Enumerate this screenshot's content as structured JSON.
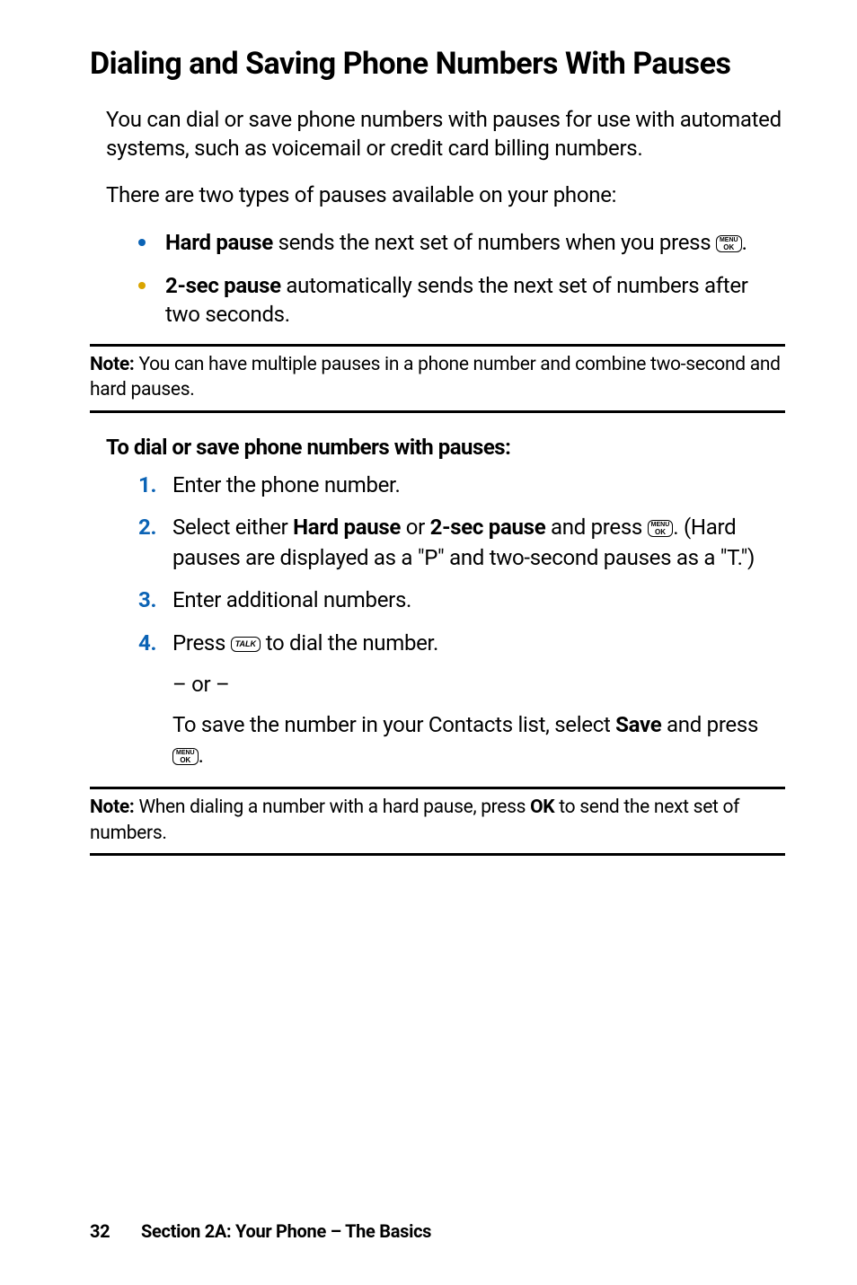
{
  "heading": "Dialing and Saving Phone Numbers With Pauses",
  "intro_para": "You can dial or save phone numbers with pauses for use with automated systems, such as voicemail or credit card billing numbers.",
  "types_para": "There are two types of pauses available on your phone:",
  "bullets": {
    "hard": {
      "label": "Hard pause",
      "text_after_label": " sends the next set of numbers when you press ",
      "text_end": "."
    },
    "twosec": {
      "label": "2-sec pause",
      "text_after_label": " automatically sends the next set of numbers after two seconds."
    }
  },
  "note1": {
    "bold": "Note:",
    "body": " You can have multiple pauses in a phone number and combine two‑second and hard pauses."
  },
  "subhead": "To dial or save phone numbers with pauses:",
  "steps": {
    "s1": {
      "num": "1.",
      "text": "Enter the phone number."
    },
    "s2": {
      "num": "2.",
      "pre": "Select either ",
      "b1": "Hard pause",
      "mid": " or ",
      "b2": "2-sec pause",
      "after": " and press ",
      "tail": ". (Hard pauses are displayed as a \"P\" and two-second pauses as a \"T.\")"
    },
    "s3": {
      "num": "3.",
      "text": "Enter additional numbers."
    },
    "s4": {
      "num": "4.",
      "pre": "Press ",
      "after": " to dial the number.",
      "or": "– or –",
      "save_pre": "To save the number in your Contacts list, select ",
      "save_b": "Save",
      "save_mid": " and press ",
      "save_end": "."
    }
  },
  "note2": {
    "bold": "Note:",
    "body_a": " When dialing a number with a hard pause, press ",
    "ok": "OK",
    "body_b": " to send the next set of numbers."
  },
  "icons": {
    "menu_ok_top": "MENU",
    "menu_ok_bot": "OK",
    "talk": "TALK"
  },
  "footer": {
    "page": "32",
    "section": "Section 2A: Your Phone – The Basics"
  }
}
